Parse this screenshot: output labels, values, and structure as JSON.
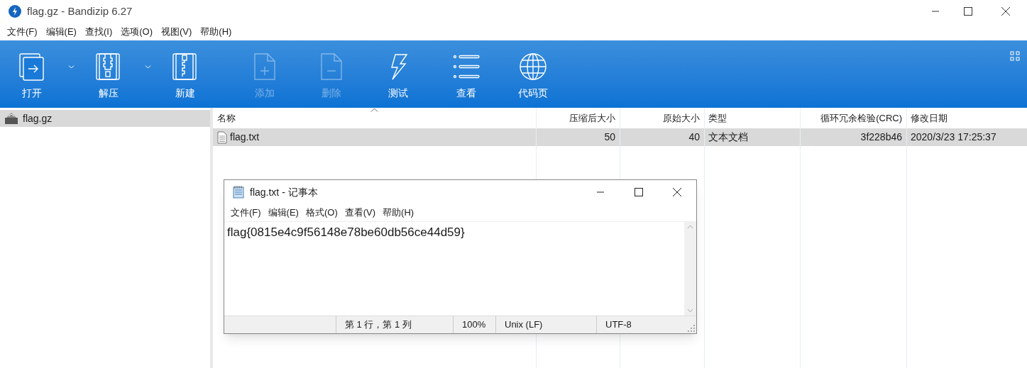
{
  "window": {
    "title": "flag.gz - Bandizip 6.27"
  },
  "menu": [
    "文件(F)",
    "编辑(E)",
    "查找(I)",
    "选项(O)",
    "视图(V)",
    "帮助(H)"
  ],
  "toolbar": [
    {
      "kind": "open",
      "label": "打开",
      "disabled": false,
      "dropdown": true
    },
    {
      "kind": "extract",
      "label": "解压",
      "disabled": false,
      "dropdown": true
    },
    {
      "kind": "new",
      "label": "新建",
      "disabled": false,
      "dropdown": false
    },
    {
      "kind": "add",
      "label": "添加",
      "disabled": true,
      "dropdown": false
    },
    {
      "kind": "delete",
      "label": "删除",
      "disabled": true,
      "dropdown": false
    },
    {
      "kind": "test",
      "label": "测试",
      "disabled": false,
      "dropdown": false
    },
    {
      "kind": "view",
      "label": "查看",
      "disabled": false,
      "dropdown": false
    },
    {
      "kind": "codepage",
      "label": "代码页",
      "disabled": false,
      "dropdown": false
    }
  ],
  "tree": [
    {
      "label": "flag.gz",
      "selected": true
    }
  ],
  "table": {
    "columns": [
      "名称",
      "压缩后大小",
      "原始大小",
      "类型",
      "循环冗余检验(CRC)",
      "修改日期"
    ],
    "rows": [
      {
        "cells": [
          "flag.txt",
          "50",
          "40",
          "文本文档",
          "3f228b46",
          "2020/3/23 17:25:37"
        ],
        "selected": true
      }
    ]
  },
  "notepad": {
    "title": "flag.txt - 记事本",
    "menu": [
      "文件(F)",
      "编辑(E)",
      "格式(O)",
      "查看(V)",
      "帮助(H)"
    ],
    "text": "flag{0815e4c9f56148e78be60db56ce44d59}",
    "status_bar": [
      "第 1 行，第 1 列",
      "100%",
      "Unix (LF)",
      "UTF-8"
    ]
  }
}
